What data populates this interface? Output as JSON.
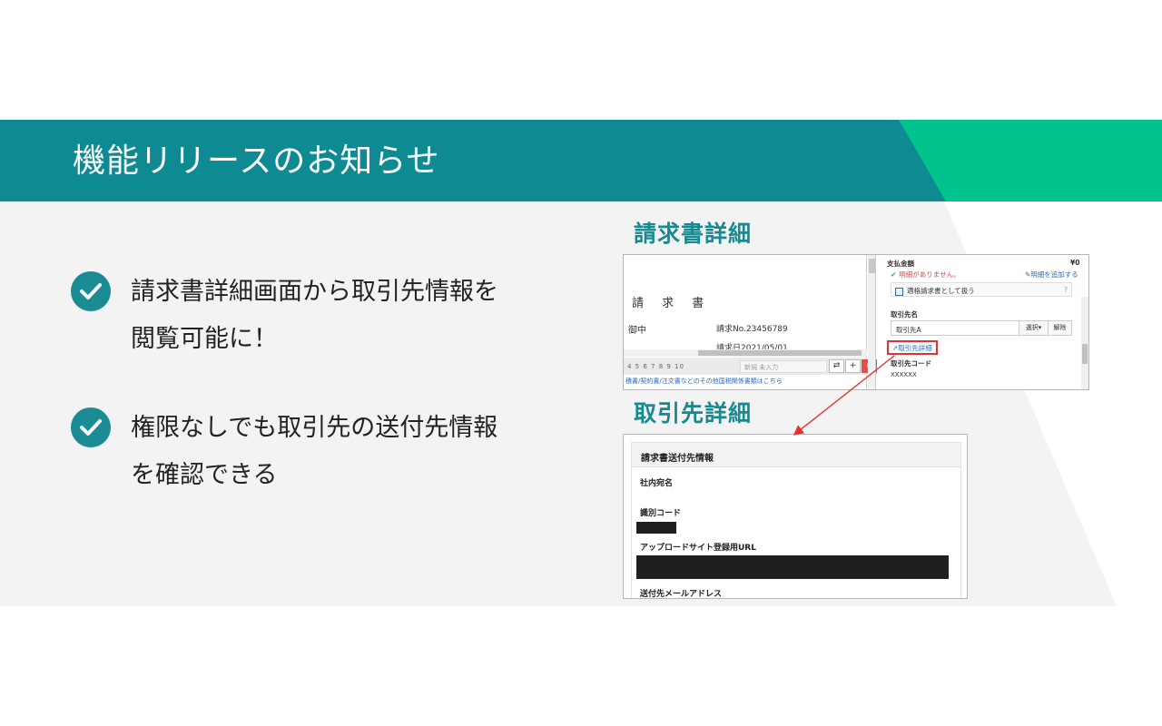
{
  "header": {
    "title": "機能リリースのお知らせ",
    "colors": {
      "bar": "#0e8a93",
      "accent": "#00c48c"
    }
  },
  "bullets": [
    {
      "icon": "check-circle-icon",
      "text": "請求書詳細画面から取引先情報を閲覧可能に！"
    },
    {
      "icon": "check-circle-icon",
      "text": "権限なしでも取引先の送付先情報を確認できる"
    }
  ],
  "sections": {
    "invoice_detail_label": "請求書詳細",
    "partner_detail_label": "取引先詳細"
  },
  "invoice_screen": {
    "doc_title": "請 求 書",
    "onchu": "御中",
    "invoice_no": "請求No.23456789",
    "invoice_date": "請求日2021/05/01",
    "page_numbers": "4 5 6 7 8 9 10",
    "new_box": "新規  未入力",
    "footer_link": "積書/契約書/注文書などのその他国税関係書類はこちら",
    "pay_label": "支払金額",
    "pay_value": "¥0",
    "no_detail_warning": "明細がありません。",
    "add_detail_link": "明細を追加する",
    "qualified_invoice_label": "適格請求書として扱う",
    "help_mark": "?",
    "partner_name_label": "取引先名",
    "partner_name_value": "取引先A",
    "select_button": "選択▾",
    "clear_button": "解除",
    "partner_detail_link": "取引先詳細",
    "partner_code_label": "取引先コード",
    "partner_code_value": "XXXXXX"
  },
  "partner_screen": {
    "section_title": "請求書送付先情報",
    "internal_addressee_label": "社内宛名",
    "id_code_label": "識別コード",
    "upload_url_label": "アップロードサイト登録用URL",
    "email_label": "送付先メールアドレス"
  }
}
